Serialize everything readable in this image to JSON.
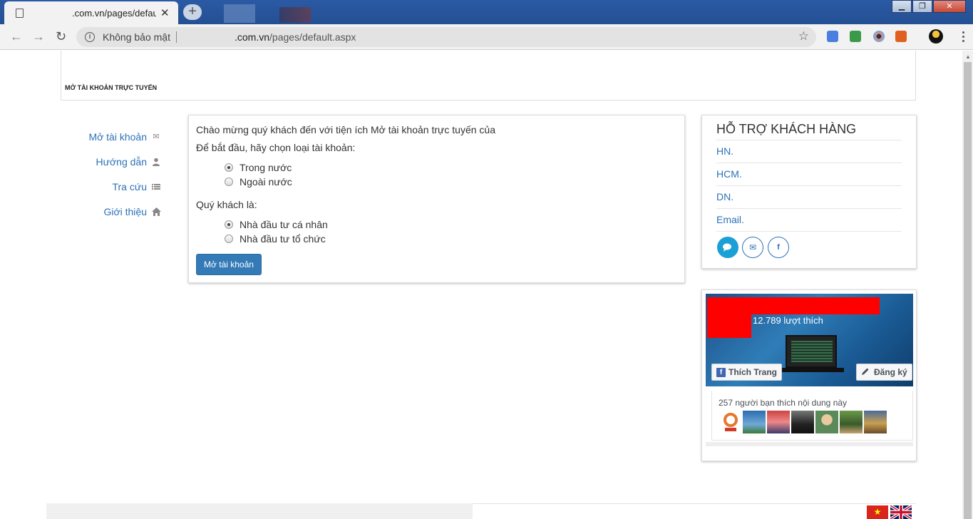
{
  "browser": {
    "tab_title": ".com.vn/pages/defau",
    "tab_close": "✕",
    "new_tab": "+",
    "security_label": "Không bảo mật",
    "url_prefix": ".com.vn",
    "url_path": "/pages/default.aspx"
  },
  "header": {
    "title": "MỞ TÀI KHOẢN TRỰC TUYẾN"
  },
  "sidebar": {
    "items": [
      {
        "label": "Mở tài khoản",
        "icon": "envelope-icon"
      },
      {
        "label": "Hướng dẫn",
        "icon": "user-icon"
      },
      {
        "label": "Tra cứu",
        "icon": "list-icon"
      },
      {
        "label": "Giới thiệu",
        "icon": "home-icon"
      }
    ]
  },
  "main": {
    "welcome": "Chào mừng quý khách đến với tiện ích Mở tài khoản trực tuyến của",
    "choose_prompt": "Để bắt đầu, hãy chọn loại tài khoản:",
    "account_types": [
      {
        "label": "Trong nước",
        "selected": true
      },
      {
        "label": "Ngoài nước",
        "selected": false
      }
    ],
    "investor_prompt": "Quý khách là:",
    "investor_types": [
      {
        "label": "Nhà đầu tư cá nhân",
        "selected": true
      },
      {
        "label": "Nhà đầu tư tổ chức",
        "selected": false
      }
    ],
    "open_button": "Mở tài khoản"
  },
  "support": {
    "title": "HỖ TRỢ KHÁCH HÀNG",
    "rows": [
      "HN.",
      "HCM.",
      "DN.",
      "Email."
    ]
  },
  "facebook": {
    "likes": "12.789 lượt thích",
    "like_button": "Thích Trang",
    "subscribe_button": "Đăng ký",
    "friends_text": "257 người bạn thích nội dung này"
  },
  "colors": {
    "link": "#2b72b8",
    "primary_button": "#337ab7",
    "redaction": "#ff0000",
    "facebook": "#4267b2"
  }
}
